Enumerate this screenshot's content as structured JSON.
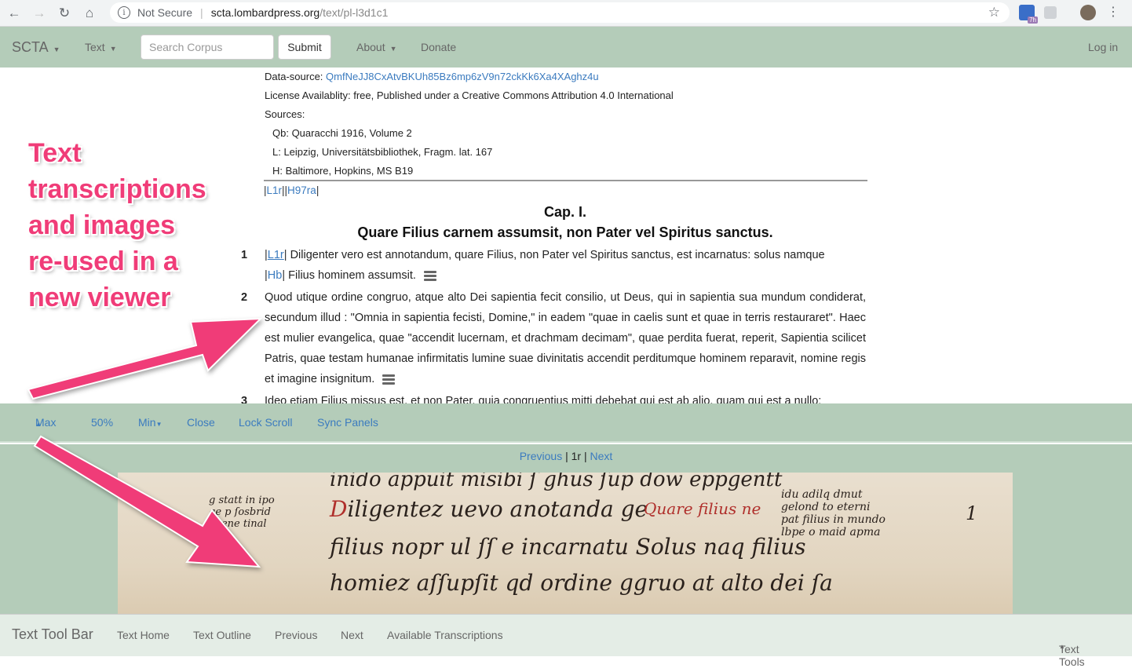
{
  "browser": {
    "security": "Not Secure",
    "host": "scta.lombardpress.org",
    "path": "/text/pl-l3d1c1",
    "ext_badge": "7h"
  },
  "navbar": {
    "brand": "SCTA",
    "text_menu": "Text",
    "search_placeholder": "Search Corpus",
    "submit": "Submit",
    "about": "About",
    "donate": "Donate",
    "login": "Log in"
  },
  "meta": {
    "datasource_label": "Data-source:",
    "datasource_value": "QmfNeJJ8CxAtvBKUh85Bz6mp6zV9n72ckKk6Xa4XAghz4u",
    "license": "License Availablity: free, Published under a Creative Commons Attribution 4.0 International",
    "sources_label": "Sources:",
    "sources": [
      "Qb: Quaracchi 1916, Volume 2",
      "L: Leipzig, Universitätsbibliothek, Fragm. lat. 167",
      "H: Baltimore, Hopkins, MS B19"
    ]
  },
  "pagerefs": [
    "L1r",
    "H97ra"
  ],
  "chapter": {
    "title": "Cap. I.",
    "subtitle": "Quare Filius carnem assumsit, non Pater vel Spiritus sanctus."
  },
  "paragraphs": [
    {
      "num": "1",
      "ref1": "L1r",
      "text1": "Diligenter vero est annotandum, quare Filius, non Pater vel Spiritus sanctus, est incarnatus: solus namque",
      "ref2": "Hb",
      "text2": "Filius hominem assumsit."
    },
    {
      "num": "2",
      "text": "Quod utique ordine congruo, atque alto Dei sapientia fecit consilio, ut Deus, qui in sapientia sua mundum condiderat, secundum illud : \"Omnia in sapientia fecisti, Domine,\" in eadem \"quae in caelis sunt et quae in terris restauraret\". Haec est mulier evangelica, quae \"accendit lucernam, et drachmam decimam\", quae perdita fuerat, reperit, Sapientia scilicet Patris, quae testam humanae infirmitatis lumine suae divinitatis accendit perditumque hominem reparavit, nomine regis et imagine insignitum."
    },
    {
      "num": "3",
      "text": "Ideo etiam Filius missus est, et non Pater, quia congruentius mitti debebat qui est ab alio, quam qui est a nullo;"
    }
  ],
  "annotation": "Text\ntranscriptions\nand images\nre-used in a\nnew viewer",
  "viewer_toolbar": {
    "max": "Max",
    "half": "50%",
    "min": "Min",
    "close": "Close",
    "lock_scroll": "Lock Scroll",
    "sync_panels": "Sync Panels"
  },
  "pager": {
    "previous": "Previous",
    "current": "1r",
    "next": "Next"
  },
  "bottom_toolbar": {
    "title": "Text Tool Bar",
    "home": "Text Home",
    "outline": "Text Outline",
    "previous": "Previous",
    "next": "Next",
    "transcriptions": "Available Transcriptions",
    "tools": "Text Tools"
  },
  "colors": {
    "navbar": "#b4ccb9",
    "link": "#3b7bbf",
    "annotation": "#f03c78"
  }
}
